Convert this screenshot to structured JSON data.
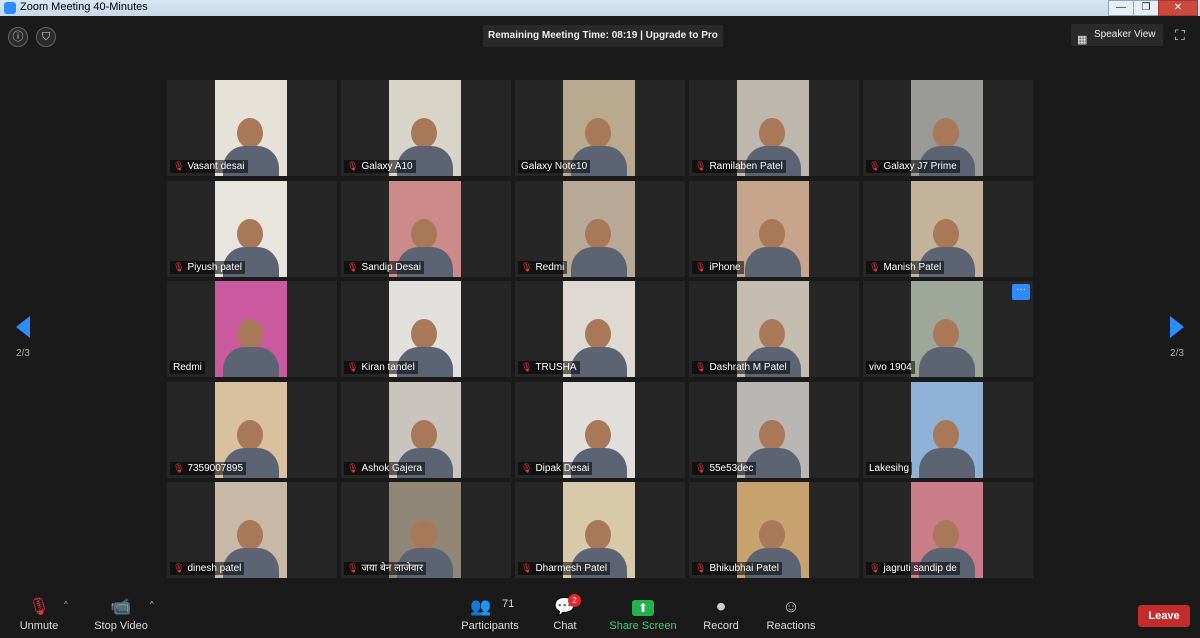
{
  "window": {
    "title": "Zoom Meeting 40-Minutes",
    "minimize": "—",
    "maximize": "❐",
    "close": "✕"
  },
  "top_bar": {
    "info_icon": "ⓘ",
    "security_icon": "⛉",
    "remaining_time": "Remaining Meeting Time: 08:19 | Upgrade to Pro",
    "speaker_view_label": "Speaker View",
    "speaker_view_icon": "▦",
    "fullscreen_icon": "⛶"
  },
  "pager": {
    "left_label": "2/3",
    "right_label": "2/3"
  },
  "participants": [
    {
      "name": "Vasant desai",
      "muted": true,
      "tone": "#e6e2da"
    },
    {
      "name": "Galaxy A10",
      "muted": true,
      "tone": "#d9d4c8"
    },
    {
      "name": "Galaxy Note10",
      "muted": false,
      "tone": "#b9a98f"
    },
    {
      "name": "Ramilaben Patel",
      "muted": true,
      "tone": "#bdb7ad"
    },
    {
      "name": "Galaxy J7 Prime",
      "muted": true,
      "tone": "#9a9a96"
    },
    {
      "name": "Piyush patel",
      "muted": true,
      "tone": "#e8e4de"
    },
    {
      "name": "Sandip Desai",
      "muted": true,
      "tone": "#cc8a88"
    },
    {
      "name": "Redmi",
      "muted": true,
      "tone": "#b8a996"
    },
    {
      "name": "iPhone",
      "muted": true,
      "tone": "#c7a58c"
    },
    {
      "name": "Manish Patel",
      "muted": true,
      "tone": "#c3b39a"
    },
    {
      "name": "Redmi",
      "muted": false,
      "tone": "#c95aa0"
    },
    {
      "name": "Kiran tandel",
      "muted": true,
      "tone": "#e2e0dc"
    },
    {
      "name": "TRUSHA",
      "muted": true,
      "tone": "#ded9d3"
    },
    {
      "name": "Dashrath M Patel",
      "muted": true,
      "tone": "#c5bdb0"
    },
    {
      "name": "vivo 1904",
      "muted": false,
      "tone": "#9fa69a"
    },
    {
      "name": "7359007895",
      "muted": true,
      "tone": "#d9c19f"
    },
    {
      "name": "Ashok Gajera",
      "muted": true,
      "tone": "#c9c4bd"
    },
    {
      "name": "Dipak Desai",
      "muted": true,
      "tone": "#e1dfdb"
    },
    {
      "name": "55e53dec",
      "muted": true,
      "tone": "#b9b7b3"
    },
    {
      "name": "Lakesihg",
      "muted": false,
      "tone": "#8fb2d6"
    },
    {
      "name": "dinesh patel",
      "muted": true,
      "tone": "#c8b9a6"
    },
    {
      "name": "जया बेन लाजेवार",
      "muted": true,
      "tone": "#8f8676"
    },
    {
      "name": "Dharmesh Patel",
      "muted": true,
      "tone": "#d8c9a8"
    },
    {
      "name": "Bhikubhai Patel",
      "muted": true,
      "tone": "#c7a26e"
    },
    {
      "name": "jagruti sandip de",
      "muted": true,
      "tone": "#c97d89"
    }
  ],
  "more_options_label": "···",
  "toolbar": {
    "unmute": {
      "label": "Unmute",
      "icon": "🎙"
    },
    "stop_video": {
      "label": "Stop Video",
      "icon": "📹"
    },
    "participants": {
      "label": "Participants",
      "icon": "👥",
      "count": "71"
    },
    "chat": {
      "label": "Chat",
      "icon": "💬",
      "badge": "2"
    },
    "share_screen": {
      "label": "Share Screen",
      "icon": "⬆"
    },
    "record": {
      "label": "Record",
      "icon": "⏺"
    },
    "reactions": {
      "label": "Reactions",
      "icon": "☺"
    },
    "caret": "^",
    "leave_label": "Leave"
  },
  "colors": {
    "accent": "#2d8cff",
    "mute_red": "#e0393e",
    "share_green": "#23b14d",
    "leave_red": "#c42b2b"
  }
}
